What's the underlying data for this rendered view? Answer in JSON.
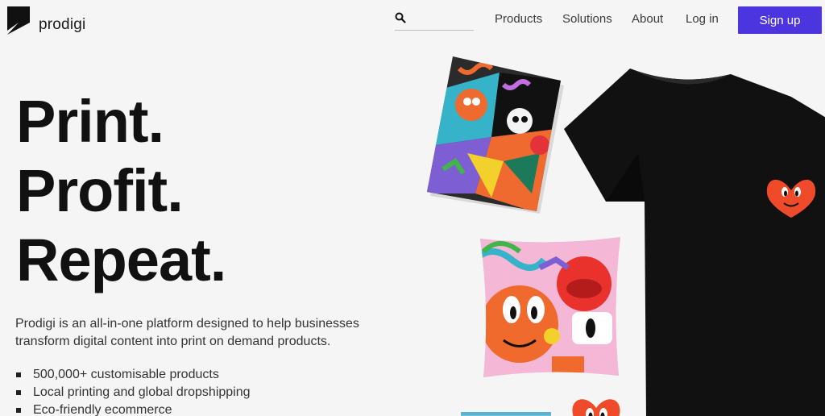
{
  "header": {
    "logo_text": "prodigi",
    "search": {
      "placeholder": "",
      "value": ""
    },
    "nav": {
      "products": "Products",
      "solutions": "Solutions",
      "about": "About",
      "login": "Log in"
    },
    "signup_label": "Sign up"
  },
  "hero": {
    "headline": [
      "Print.",
      "Profit.",
      "Repeat."
    ],
    "description": "Prodigi is an all-in-one platform designed to help businesses transform digital content into print on demand products.",
    "features": [
      "500,000+ customisable products",
      "Local printing and global dropshipping",
      "Eco-friendly ecommerce"
    ]
  },
  "colors": {
    "background": "#f5f5f5",
    "accent": "#4c34de",
    "text": "#141414",
    "tshirt": "#111111",
    "heart": "#ef4b2a"
  },
  "icons": {
    "logo": "prodigi-logo-icon",
    "search": "search-icon"
  }
}
